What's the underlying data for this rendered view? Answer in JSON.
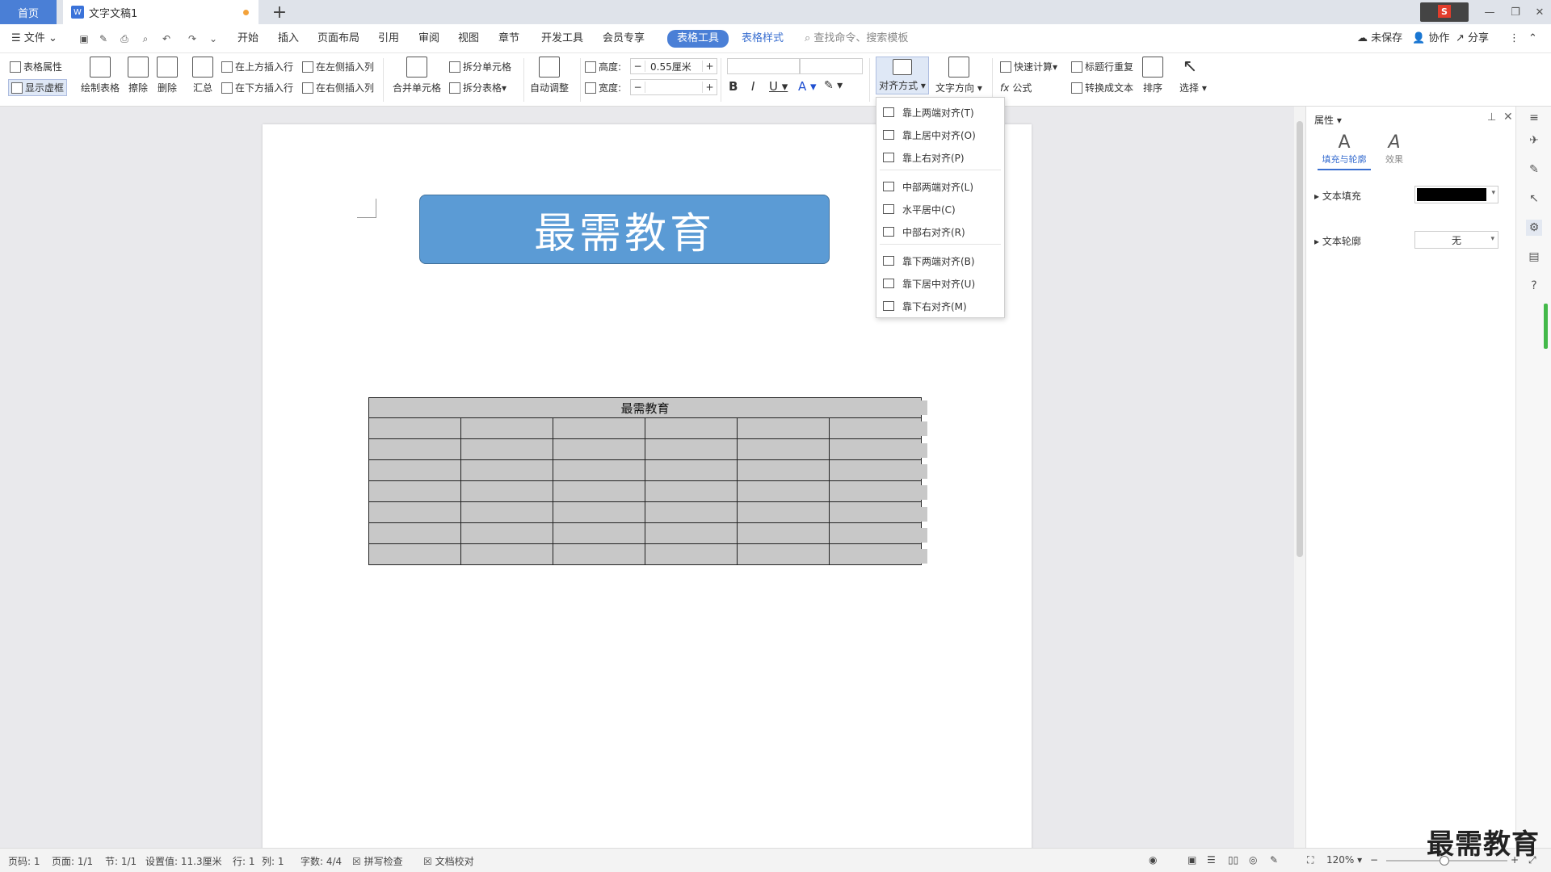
{
  "tabs": {
    "home": "首页",
    "doc": "文字文稿1"
  },
  "menu": {
    "file": "文件",
    "tabs": [
      "开始",
      "插入",
      "页面布局",
      "引用",
      "审阅",
      "视图",
      "章节",
      "开发工具",
      "会员专享"
    ],
    "active_tab": "表格工具",
    "style_tab": "表格样式",
    "search_placeholder": "查找命令、搜索模板",
    "unsaved": "未保存",
    "collab": "协作",
    "share": "分享"
  },
  "ribbon": {
    "table_props": "表格属性",
    "show_gridlines": "显示虚框",
    "draw_table": "绘制表格",
    "erase": "擦除",
    "delete": "删除",
    "summary": "汇总",
    "insert_above": "在上方插入行",
    "insert_below": "在下方插入行",
    "insert_left": "在左侧插入列",
    "insert_right": "在右侧插入列",
    "merge_cells": "合并单元格",
    "split_cells": "拆分单元格",
    "split_table": "拆分表格",
    "auto_fit": "自动调整",
    "height_label": "高度:",
    "height_value": "0.55厘米",
    "width_label": "宽度:",
    "align": "对齐方式",
    "text_direction": "文字方向",
    "quick_calc": "快速计算",
    "repeat_header": "标题行重复",
    "formula": "公式",
    "convert_text": "转换成文本",
    "sort": "排序",
    "select": "选择"
  },
  "document": {
    "banner_text": "最需教育",
    "table_header": "最需教育",
    "rows": 7,
    "cols": 6
  },
  "align_menu": {
    "groups": [
      [
        "靠上两端对齐(T)",
        "靠上居中对齐(O)",
        "靠上右对齐(P)"
      ],
      [
        "中部两端对齐(L)",
        "水平居中(C)",
        "中部右对齐(R)"
      ],
      [
        "靠下两端对齐(B)",
        "靠下居中对齐(U)",
        "靠下右对齐(M)"
      ]
    ]
  },
  "panel": {
    "title": "属性",
    "tab_fill": "填充与轮廓",
    "tab_effect": "效果",
    "text_fill": "文本填充",
    "text_outline": "文本轮廓",
    "outline_value": "无",
    "fill_color": "#000000"
  },
  "status": {
    "page_num": "页码: 1",
    "pages": "页面: 1/1",
    "section": "节: 1/1",
    "setting": "设置值: 11.3厘米",
    "row": "行: 1",
    "col": "列: 1",
    "words": "字数: 4/4",
    "spell": "拼写检查",
    "proof": "文档校对",
    "zoom": "120%"
  },
  "watermark": "最需教育",
  "colors": {
    "accent": "#4a7fd6",
    "banner": "#5b9bd5",
    "table_fill": "#c8c8c8"
  }
}
